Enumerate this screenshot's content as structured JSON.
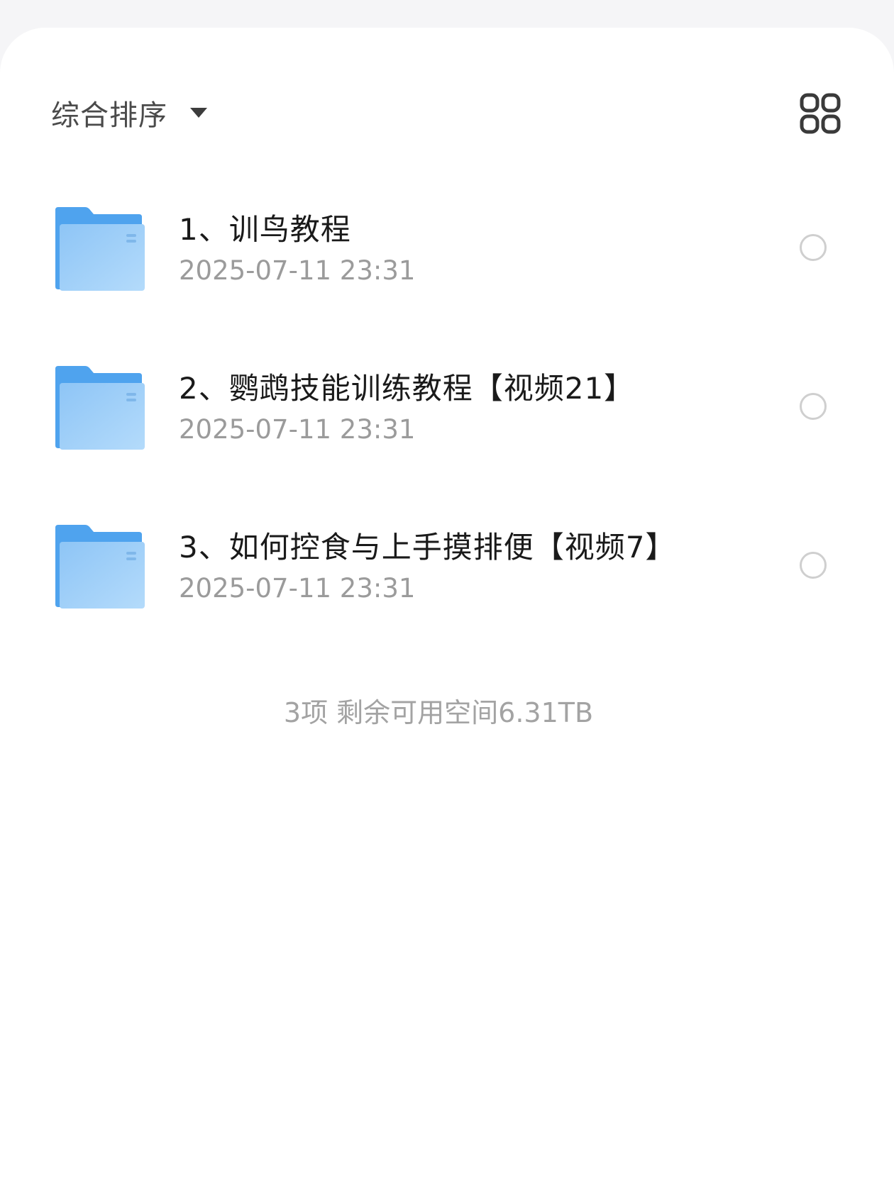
{
  "toolbar": {
    "sort_label": "综合排序",
    "sort_icon": "caret-down-icon",
    "view_toggle_icon": "grid-view-icon"
  },
  "files": [
    {
      "name": "1、训鸟教程",
      "date": "2025-07-11 23:31",
      "icon": "folder-icon",
      "selected": false
    },
    {
      "name": "2、鹦鹉技能训练教程【视频21】",
      "date": "2025-07-11 23:31",
      "icon": "folder-icon",
      "selected": false
    },
    {
      "name": "3、如何控食与上手摸排便【视频7】",
      "date": "2025-07-11 23:31",
      "icon": "folder-icon",
      "selected": false
    }
  ],
  "footer": {
    "summary": "3项 剩余可用空间6.31TB"
  },
  "colors": {
    "folder_back": "#4fa3ee",
    "folder_front": "#9ccdf8",
    "text_primary": "#1a1a1a",
    "text_secondary": "#9b9b9b"
  }
}
